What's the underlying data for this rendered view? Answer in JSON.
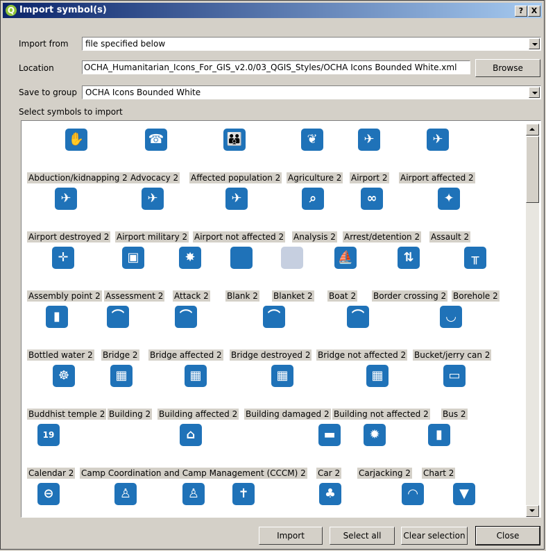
{
  "window": {
    "title": "Import symbol(s)",
    "help_label": "?",
    "close_label": "X"
  },
  "form": {
    "import_from_label": "Import from",
    "import_from_value": "file specified below",
    "location_label": "Location",
    "location_value": "OCHA_Humanitarian_Icons_For_GIS_v2.0/03_QGIS_Styles/OCHA Icons Bounded White.xml",
    "browse_label": "Browse",
    "save_group_label": "Save to group",
    "save_group_value": "OCHA Icons Bounded White",
    "select_label": "Select symbols to import"
  },
  "symbols": [
    {
      "name": "Abduction/kidnapping 2",
      "icon": "abduction-icon"
    },
    {
      "name": "Advocacy 2",
      "icon": "advocacy-icon"
    },
    {
      "name": "Affected population 2",
      "icon": "affected-population-icon"
    },
    {
      "name": "Agriculture 2",
      "icon": "agriculture-icon"
    },
    {
      "name": "Airport 2",
      "icon": "airport-icon"
    },
    {
      "name": "Airport affected 2",
      "icon": "airport-affected-icon"
    },
    {
      "name": "Airport destroyed 2",
      "icon": "airport-destroyed-icon"
    },
    {
      "name": "Airport military 2",
      "icon": "airport-military-icon"
    },
    {
      "name": "Airport not affected 2",
      "icon": "airport-not-affected-icon"
    },
    {
      "name": "Analysis 2",
      "icon": "analysis-icon"
    },
    {
      "name": "Arrest/detention 2",
      "icon": "arrest-icon"
    },
    {
      "name": "Assault 2",
      "icon": "assault-icon"
    },
    {
      "name": "Assembly point 2",
      "icon": "assembly-point-icon"
    },
    {
      "name": "Assessment 2",
      "icon": "assessment-icon"
    },
    {
      "name": "Attack 2",
      "icon": "attack-icon"
    },
    {
      "name": "Blank 2",
      "icon": "blank-icon"
    },
    {
      "name": "Blanket 2",
      "icon": "blanket-icon"
    },
    {
      "name": "Boat 2",
      "icon": "boat-icon"
    },
    {
      "name": "Border crossing 2",
      "icon": "border-crossing-icon"
    },
    {
      "name": "Borehole 2",
      "icon": "borehole-icon"
    },
    {
      "name": "Bottled water 2",
      "icon": "bottled-water-icon"
    },
    {
      "name": "Bridge 2",
      "icon": "bridge-icon"
    },
    {
      "name": "Bridge affected 2",
      "icon": "bridge-affected-icon"
    },
    {
      "name": "Bridge destroyed 2",
      "icon": "bridge-destroyed-icon"
    },
    {
      "name": "Bridge not affected 2",
      "icon": "bridge-not-affected-icon"
    },
    {
      "name": "Bucket/jerry can 2",
      "icon": "bucket-icon"
    },
    {
      "name": "Buddhist temple 2",
      "icon": "buddhist-temple-icon"
    },
    {
      "name": "Building 2",
      "icon": "building-icon"
    },
    {
      "name": "Building affected 2",
      "icon": "building-affected-icon"
    },
    {
      "name": "Building damaged 2",
      "icon": "building-damaged-icon"
    },
    {
      "name": "Building not affected 2",
      "icon": "building-not-affected-icon"
    },
    {
      "name": "Bus 2",
      "icon": "bus-icon"
    },
    {
      "name": "Calendar 2",
      "icon": "calendar-icon"
    },
    {
      "name": "Camp Coordination and Camp Management (CCCM) 2",
      "icon": "cccm-icon"
    },
    {
      "name": "Car 2",
      "icon": "car-icon"
    },
    {
      "name": "Carjacking 2",
      "icon": "carjacking-icon"
    },
    {
      "name": "Chart 2",
      "icon": "chart-icon"
    }
  ],
  "partial_row_icons": [
    "no-entry-icon",
    "child-icon",
    "children-icon",
    "church-icon",
    "cluster-icon",
    "communication-icon",
    "clothing-icon"
  ],
  "buttons": {
    "import": "Import",
    "select_all": "Select all",
    "clear_selection": "Clear selection",
    "close": "Close"
  }
}
